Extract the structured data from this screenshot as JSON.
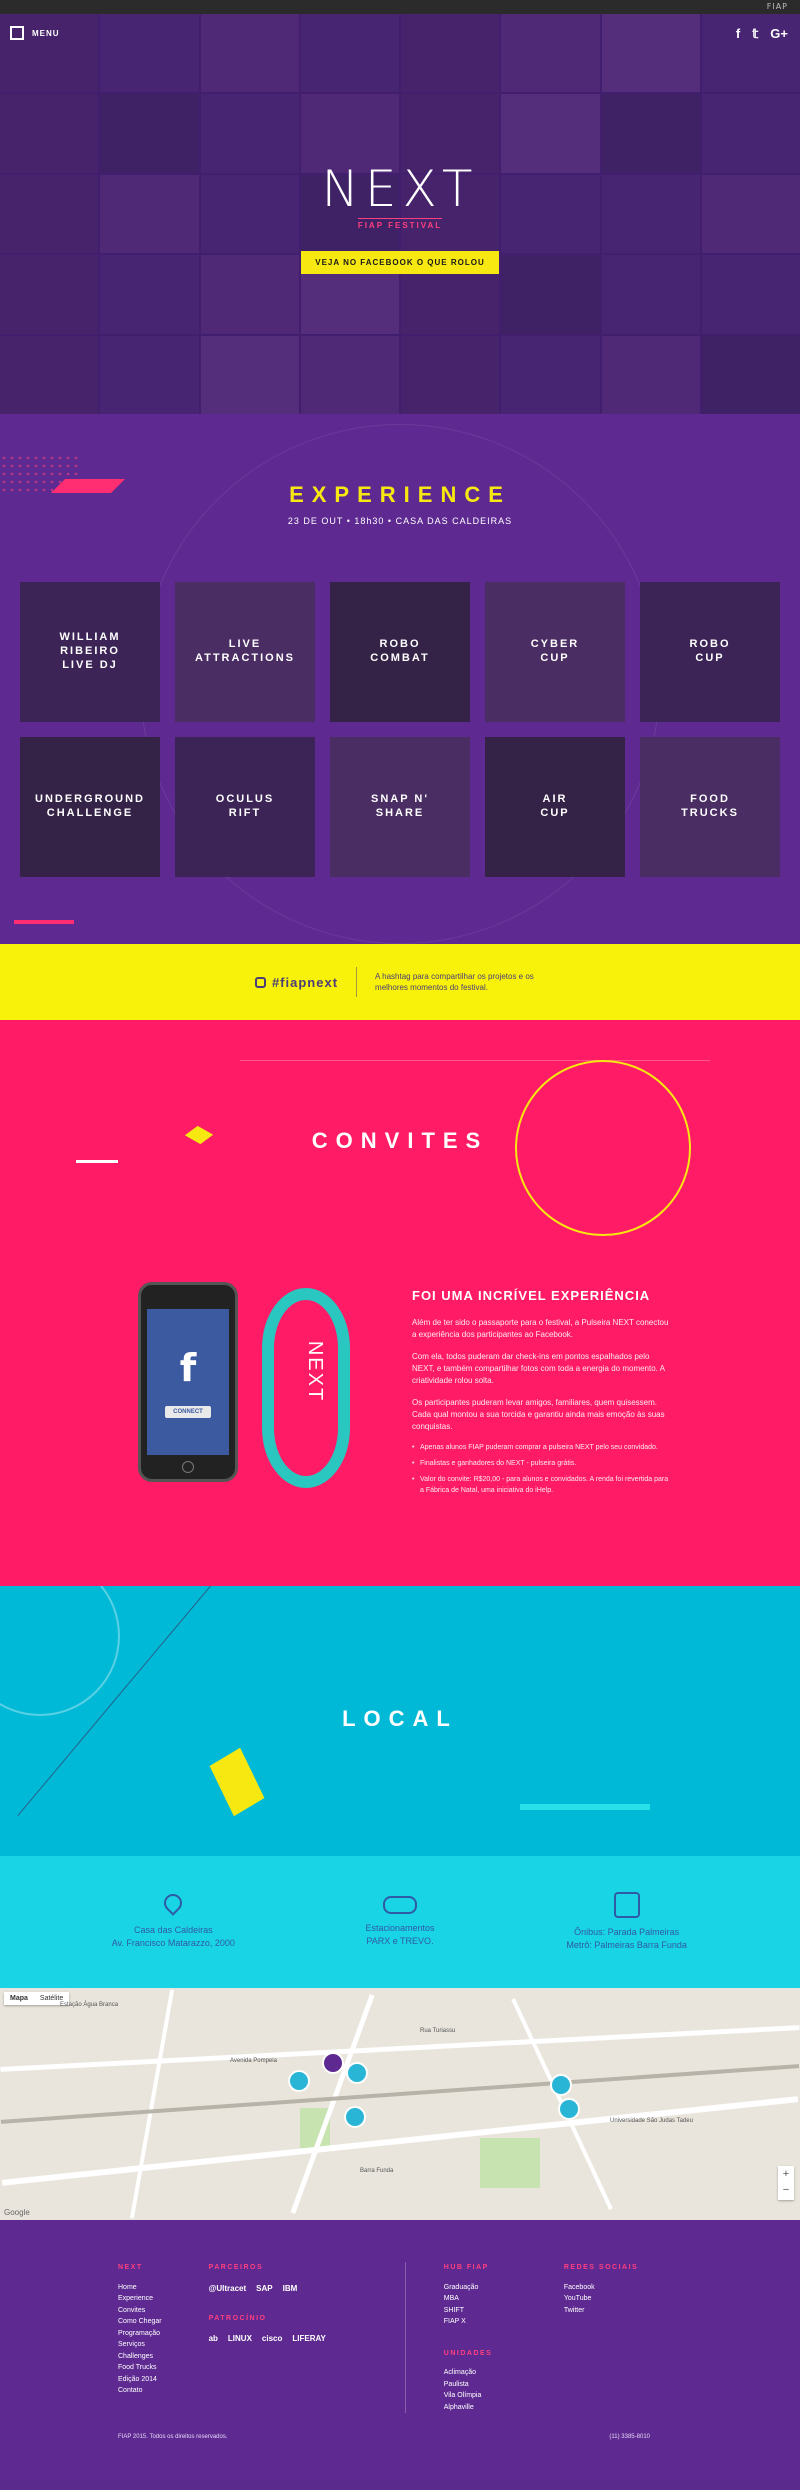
{
  "topbar": {
    "brand": "FIAP"
  },
  "hero": {
    "menu_label": "MENU",
    "social": [
      "f",
      "𝕥",
      "G+"
    ],
    "logo": "NEXT",
    "sublogo": "FIAP FESTIVAL",
    "cta": "VEJA NO FACEBOOK O QUE ROLOU"
  },
  "experience": {
    "title": "EXPERIENCE",
    "date": "23 DE OUT • 18h30 • CASA DAS CALDEIRAS",
    "cards": [
      "WILLIAM\nRIBEIRO\nLIVE DJ",
      "LIVE\nATTRACTIONS",
      "ROBO\nCOMBAT",
      "CYBER\nCUP",
      "ROBO\nCUP",
      "UNDERGROUND\nCHALLENGE",
      "OCULUS\nRIFT",
      "SNAP N'\nSHARE",
      "AIR\nCUP",
      "FOOD\nTRUCKS"
    ]
  },
  "hashtag": {
    "tag": "#fiapnext",
    "note": "A hashtag para compartilhar os projetos e os melhores momentos do festival."
  },
  "convites": {
    "title": "CONVITES",
    "phone_f": "f",
    "phone_connect": "CONNECT",
    "band_name": "NEXT",
    "heading": "FOI UMA INCRÍVEL EXPERIÊNCIA",
    "p1": "Além de ter sido o passaporte para o festival, a Pulseira NEXT conectou a experiência dos participantes ao Facebook.",
    "p2": "Com ela, todos puderam dar check-ins em pontos espalhados pelo NEXT, e também compartilhar fotos com toda a energia do momento. A criatividade rolou solta.",
    "p3": "Os participantes puderam levar amigos, familiares, quem quisessem. Cada qual montou a sua torcida e garantiu ainda mais emoção às suas conquistas.",
    "bullets": [
      "Apenas alunos FIAP puderam comprar a pulseira NEXT pelo seu convidado.",
      "Finalistas e ganhadores do NEXT - pulseira grátis.",
      "Valor do convite: R$20,00 - para alunos e convidados. A renda foi revertida para a Fábrica de Natal, uma iniciativa do iHelp."
    ]
  },
  "local": {
    "title": "LOCAL",
    "info": [
      {
        "icon": "map-pin-icon",
        "line1": "Casa das Caldeiras",
        "line2": "Av. Francisco Matarazzo, 2000"
      },
      {
        "icon": "car-icon",
        "line1": "Estacionamentos",
        "line2": "PARX e TREVO."
      },
      {
        "icon": "bus-icon",
        "line1": "Ônibus: Parada Palmeiras",
        "line2": "Metrô: Palmeiras Barra Funda"
      }
    ]
  },
  "map": {
    "tabs": [
      "Mapa",
      "Satélite"
    ],
    "google": "Google",
    "places": [
      "Estação Água Branca",
      "Universidade São Judas Tadeu",
      "Rua Turiassu",
      "Avenida Pompeia",
      "Barra Funda"
    ]
  },
  "footer": {
    "next_heading": "NEXT",
    "next_links": [
      "Home",
      "Experience",
      "Convites",
      "Como Chegar",
      "Programação",
      "Serviços",
      "Challenges",
      "Food Trucks",
      "Edição 2014",
      "Contato"
    ],
    "partners_heading": "PARCEIROS",
    "partners": [
      "@Ultracet",
      "SAP",
      "IBM"
    ],
    "sponsors_heading": "PATROCÍNIO",
    "sponsors": [
      "ab",
      "LINUX",
      "cisco",
      "LIFERAY"
    ],
    "hub_heading": "HUB FIAP",
    "hub_links": [
      "Graduação",
      "MBA",
      "SHIFT",
      "FIAP X"
    ],
    "units_heading": "UNIDADES",
    "units": [
      "Aclimação",
      "Paulista",
      "Vila Olímpia",
      "Alphaville"
    ],
    "social_heading": "REDES SOCIAIS",
    "social_links": [
      "Facebook",
      "YouTube",
      "Twitter"
    ],
    "copyright": "FIAP 2015. Todos os direitos reservados.",
    "phone": "(11) 3385-8010"
  }
}
